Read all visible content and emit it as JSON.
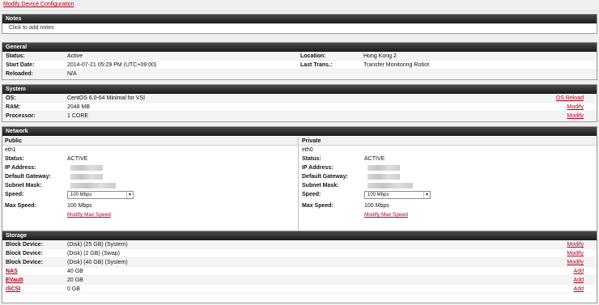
{
  "top_link": "Modify Device Configuration",
  "notes": {
    "title": "Notes",
    "placeholder": "Click to add notes"
  },
  "general": {
    "title": "General",
    "status_label": "Status:",
    "status_value": "Active",
    "start_label": "Start Date:",
    "start_value": "2014-07-21 05:29 PM (UTC+09:00)",
    "reloaded_label": "Reloaded:",
    "reloaded_value": "N/A",
    "location_label": "Location:",
    "location_value": "Hong Kong 2",
    "trans_label": "Last Trans.:",
    "trans_value": "Transfer Monitoring Robot"
  },
  "system": {
    "title": "System",
    "os_label": "OS:",
    "os_value": "CentOS 6.0-64 Minimal for VSI",
    "os_action": "OS Reload",
    "ram_label": "RAM:",
    "ram_value": "2048 MB",
    "ram_action": "Modify",
    "proc_label": "Processor:",
    "proc_value": "1 CORE",
    "proc_action": "Modify"
  },
  "network": {
    "title": "Network",
    "public": {
      "title": "Public",
      "iface": "eth1",
      "status_label": "Status:",
      "status_value": "ACTIVE",
      "ip_label": "IP Address:",
      "gw_label": "Default Gateway:",
      "mask_label": "Subnet Mask:",
      "speed_label": "Speed:",
      "speed_value": "100 Mbps",
      "max_label": "Max Speed:",
      "max_value": "100 Mbps",
      "modify_link": "Modify Max Speed"
    },
    "private": {
      "title": "Private",
      "iface": "eth0",
      "status_label": "Status:",
      "status_value": "ACTIVE",
      "ip_label": "IP Address:",
      "gw_label": "Default Gateway:",
      "mask_label": "Subnet Mask:",
      "speed_label": "Speed:",
      "speed_value": "100 Mbps",
      "max_label": "Max Speed:",
      "max_value": "100 Mbps",
      "modify_link": "Modify Max Speed"
    }
  },
  "storage": {
    "title": "Storage",
    "rows": [
      {
        "label": "Block Device:",
        "value": "(Disk) (25 GB) (System)",
        "action": "Modify"
      },
      {
        "label": "Block Device:",
        "value": "(Disk) (2 GB) (Swap)",
        "action": "Modify"
      },
      {
        "label": "Block Device:",
        "value": "(Disk) (40 GB) (System)",
        "action": "Modify"
      },
      {
        "label": "NAS",
        "value": "40 GB",
        "action": "Add"
      },
      {
        "label": "EVault",
        "value": "20 GB",
        "action": "Add"
      },
      {
        "label": "iSCSI",
        "value": "0 GB",
        "action": "Add"
      }
    ]
  }
}
